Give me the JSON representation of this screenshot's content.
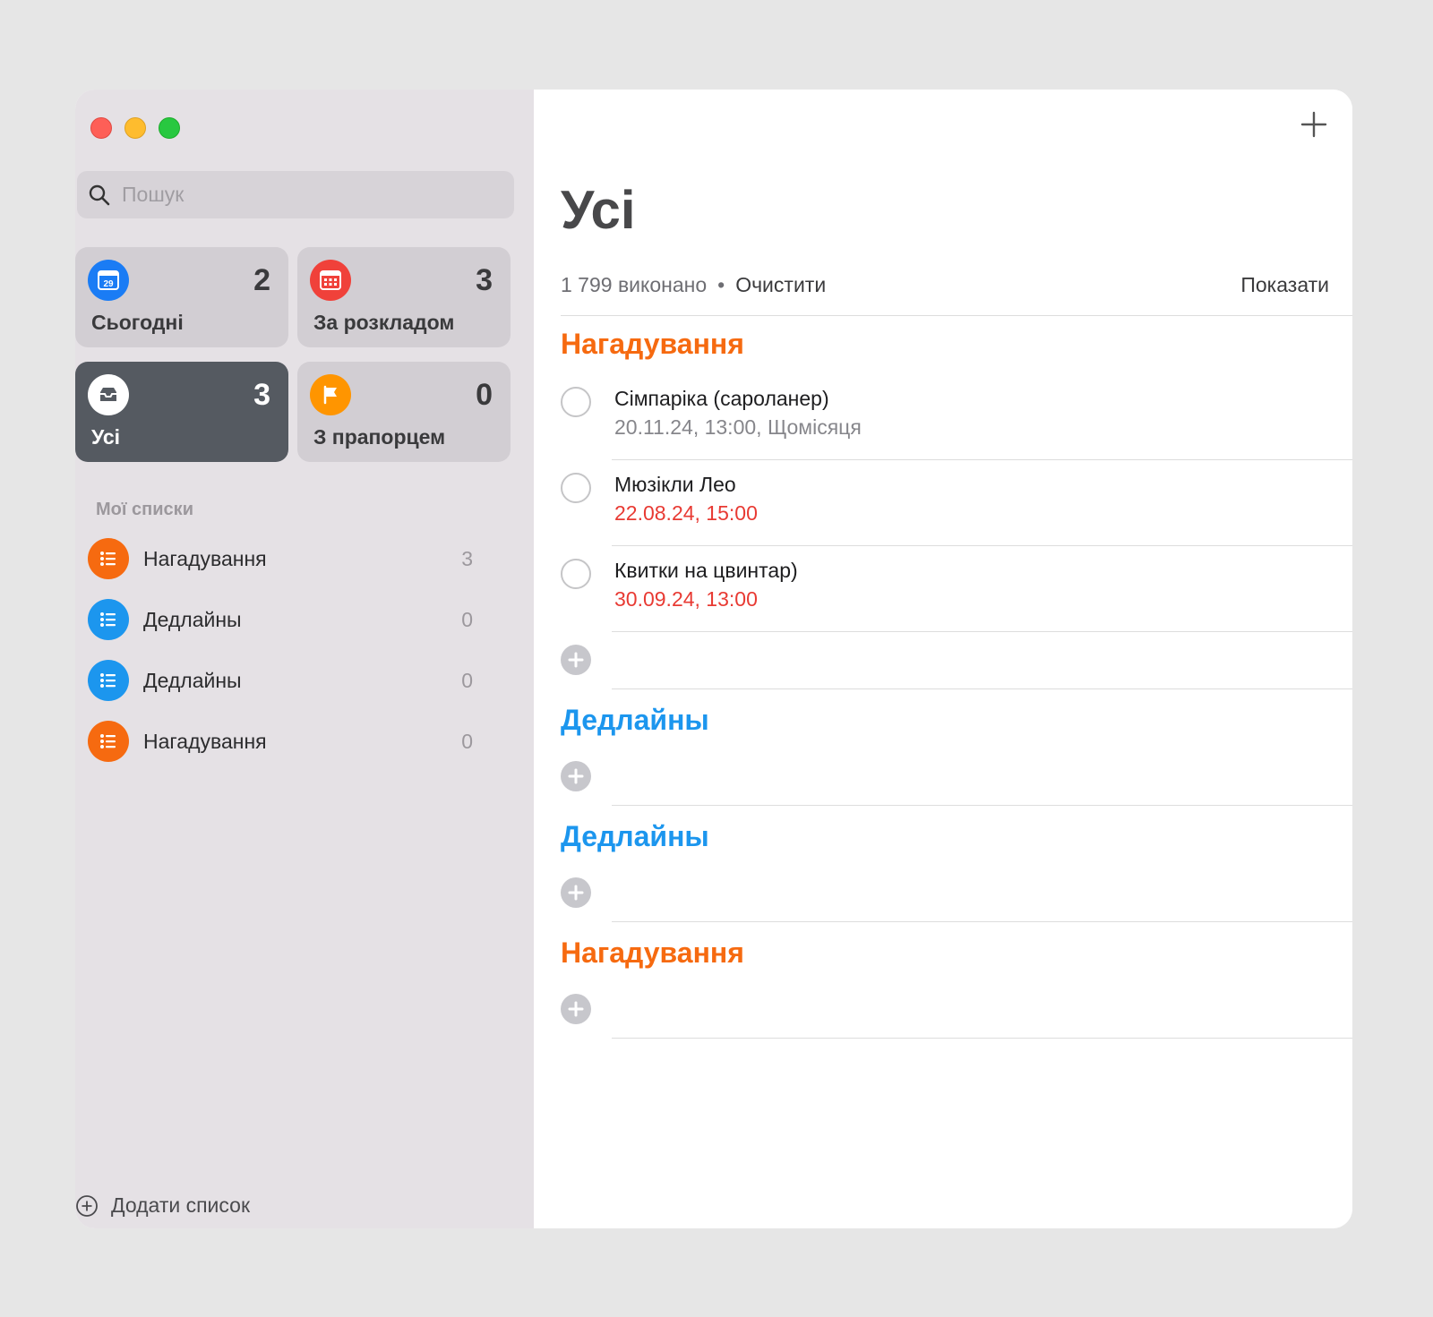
{
  "sidebar": {
    "search_placeholder": "Пошук",
    "smart_lists": [
      {
        "label": "Сьогодні",
        "count": "2",
        "icon": "calendar-today-icon",
        "day": "29",
        "color": "#1a7cf5"
      },
      {
        "label": "За розкладом",
        "count": "3",
        "icon": "calendar-scheduled-icon",
        "color": "#f0413a"
      },
      {
        "label": "Усі",
        "count": "3",
        "icon": "inbox-icon",
        "color": "#ffffff",
        "selected": true
      },
      {
        "label": "З прапорцем",
        "count": "0",
        "icon": "flag-icon",
        "color": "#ff9500"
      }
    ],
    "my_lists_title": "Мої списки",
    "lists": [
      {
        "name": "Нагадування",
        "count": "3",
        "color": "#f66a10",
        "icon": "list-bullet-icon"
      },
      {
        "name": "Дедлайны",
        "count": "0",
        "color": "#1c96ee",
        "icon": "list-bullet-icon"
      },
      {
        "name": "Дедлайны",
        "count": "0",
        "color": "#1c96ee",
        "icon": "list-bullet-icon"
      },
      {
        "name": "Нагадування",
        "count": "0",
        "color": "#f66a10",
        "icon": "list-bullet-icon"
      }
    ],
    "add_list_label": "Додати список"
  },
  "main": {
    "title": "Усі",
    "completed_text": "1 799 виконано",
    "separator": "•",
    "clear_label": "Очистити",
    "show_label": "Показати",
    "sections": [
      {
        "title": "Нагадування",
        "color": "#f66a10",
        "tasks": [
          {
            "name": "Сімпаріка (сароланер)",
            "meta": "20.11.24, 13:00, Щомісяця",
            "meta_color": "#86868b"
          },
          {
            "name": "Мюзікли Лео",
            "meta": "22.08.24, 15:00",
            "meta_color": "#e83a33"
          },
          {
            "name": "Квитки на цвинтар)",
            "meta": "30.09.24, 13:00",
            "meta_color": "#e83a33"
          }
        ]
      },
      {
        "title": "Дедлайны",
        "color": "#1c96ee",
        "tasks": []
      },
      {
        "title": "Дедлайны",
        "color": "#1c96ee",
        "tasks": []
      },
      {
        "title": "Нагадування",
        "color": "#f66a10",
        "tasks": []
      }
    ]
  }
}
